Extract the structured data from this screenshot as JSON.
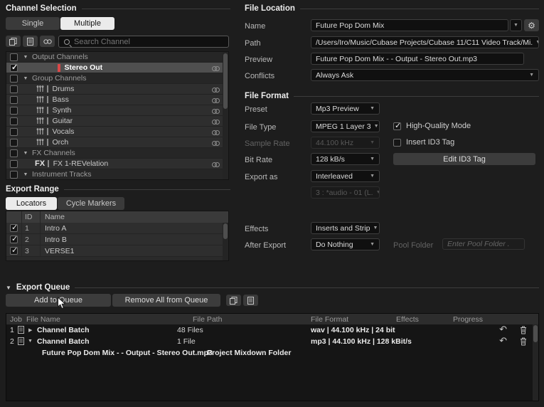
{
  "channel_selection": {
    "title": "Channel Selection",
    "tab_single": "Single",
    "tab_multiple": "Multiple",
    "search_placeholder": "Search Channel",
    "output_header": {
      "label": "Output Channels",
      "checked": false
    },
    "stereo_out": {
      "label": "Stereo Out",
      "checked": true
    },
    "group_header": {
      "label": "Group Channels",
      "checked": false
    },
    "drums": {
      "label": "Drums",
      "checked": false
    },
    "bass": {
      "label": "Bass",
      "checked": false
    },
    "synth": {
      "label": "Synth",
      "checked": false
    },
    "guitar": {
      "label": "Guitar",
      "checked": false
    },
    "vocals": {
      "label": "Vocals",
      "checked": false
    },
    "orch": {
      "label": "Orch",
      "checked": false
    },
    "fx_header": {
      "label": "FX Channels",
      "checked": false
    },
    "fx1": {
      "badge": "FX",
      "label": "FX 1-REVelation",
      "checked": false
    },
    "instrument_header": {
      "label": "Instrument Tracks",
      "checked": false
    }
  },
  "export_range": {
    "title": "Export Range",
    "tab_locators": "Locators",
    "tab_cycle_markers": "Cycle Markers",
    "columns": {
      "id": "ID",
      "name": "Name"
    },
    "rows": [
      {
        "id": "1",
        "name": "Intro A",
        "checked": true
      },
      {
        "id": "2",
        "name": "Intro B",
        "checked": true
      },
      {
        "id": "3",
        "name": "VERSE1",
        "checked": true
      }
    ]
  },
  "file_location": {
    "title": "File Location",
    "name_label": "Name",
    "name_value": "Future Pop Dom Mix",
    "path_label": "Path",
    "path_value": "/Users/Iro/Music/Cubase Projects/Cubase 11/C11 Video Track/Mi.",
    "preview_label": "Preview",
    "preview_value": "Future Pop Dom Mix -  - Output - Stereo Out.mp3",
    "conflicts_label": "Conflicts",
    "conflicts_value": "Always Ask"
  },
  "file_format": {
    "title": "File Format",
    "preset_label": "Preset",
    "preset_value": "Mp3 Preview",
    "file_type_label": "File Type",
    "file_type_value": "MPEG 1 Layer 3",
    "sample_rate_label": "Sample Rate",
    "sample_rate_value": "44.100 kHz",
    "bit_rate_label": "Bit Rate",
    "bit_rate_value": "128 kB/s",
    "export_as_label": "Export as",
    "export_as_value": "Interleaved",
    "channel_slot_value": "3 : *audio - 01 (L.",
    "high_quality": {
      "label": "High-Quality Mode",
      "checked": true
    },
    "id3_tag": {
      "label": "Insert ID3 Tag",
      "checked": false
    },
    "edit_id3_button": "Edit ID3 Tag",
    "effects_label": "Effects",
    "effects_value": "Inserts and Strip",
    "after_export_label": "After Export",
    "after_export_value": "Do Nothing",
    "pool_folder_label": "Pool Folder",
    "pool_folder_placeholder": "Enter Pool Folder ."
  },
  "export_queue": {
    "title": "Export Queue",
    "add_button": "Add to Queue",
    "remove_button": "Remove All from Queue",
    "columns": [
      "Job",
      "File Name",
      "File Path",
      "File Format",
      "Effects",
      "Progress"
    ],
    "rows": [
      {
        "job": "1",
        "file_name": "Channel Batch",
        "count": "48 Files",
        "file_format": "wav | 44.100 kHz | 24 bit"
      },
      {
        "job": "2",
        "file_name": "Channel Batch",
        "count": "1 File",
        "file_format": "mp3 | 44.100 kHz | 128 kBit/s"
      }
    ],
    "sub_row": {
      "file_name": "Future Pop Dom Mix -  - Output - Stereo Out.mp3",
      "file_path": "Project Mixdown Folder"
    }
  }
}
